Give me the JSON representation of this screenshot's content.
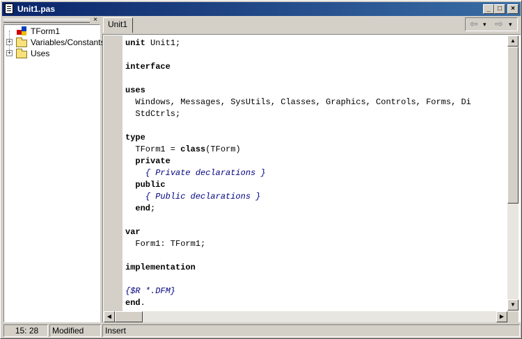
{
  "window": {
    "title": "Unit1.pas"
  },
  "title_buttons": {
    "minimize": "_",
    "maximize": "□",
    "close": "×"
  },
  "tree": {
    "items": [
      {
        "label": "TForm1",
        "icon": "class-icon"
      },
      {
        "label": "Variables/Constants",
        "icon": "folder-icon",
        "expander": "+"
      },
      {
        "label": "Uses",
        "icon": "folder-icon",
        "expander": "+"
      }
    ],
    "close_glyph": "×"
  },
  "tabs": [
    {
      "label": "Unit1"
    }
  ],
  "nav": {
    "back_glyph": "⇦",
    "forward_glyph": "⇨",
    "drop_glyph": "▾"
  },
  "code_lines": [
    [
      {
        "t": "unit",
        "k": "kw"
      },
      {
        "t": " Unit1;"
      }
    ],
    [],
    [
      {
        "t": "interface",
        "k": "kw"
      }
    ],
    [],
    [
      {
        "t": "uses",
        "k": "kw"
      }
    ],
    [
      {
        "t": "  Windows, Messages, SysUtils, Classes, Graphics, Controls, Forms, Di"
      }
    ],
    [
      {
        "t": "  StdCtrls;"
      }
    ],
    [],
    [
      {
        "t": "type",
        "k": "kw"
      }
    ],
    [
      {
        "t": "  TForm1 = "
      },
      {
        "t": "class",
        "k": "kw"
      },
      {
        "t": "(TForm)"
      }
    ],
    [
      {
        "t": "  "
      },
      {
        "t": "private",
        "k": "kw"
      }
    ],
    [
      {
        "t": "    "
      },
      {
        "t": "{ Private declarations }",
        "k": "cm"
      }
    ],
    [
      {
        "t": "  "
      },
      {
        "t": "public",
        "k": "kw"
      }
    ],
    [
      {
        "t": "    "
      },
      {
        "t": "{ Public declarations }",
        "k": "cm"
      }
    ],
    [
      {
        "t": "  "
      },
      {
        "t": "end",
        "k": "kw"
      },
      {
        "t": ";"
      }
    ],
    [],
    [
      {
        "t": "var",
        "k": "kw"
      }
    ],
    [
      {
        "t": "  Form1: TForm1;"
      }
    ],
    [],
    [
      {
        "t": "implementation",
        "k": "kw"
      }
    ],
    [],
    [
      {
        "t": "{$R *.DFM}",
        "k": "cm"
      }
    ],
    [
      {
        "t": "end",
        "k": "kw"
      },
      {
        "t": "."
      }
    ]
  ],
  "status": {
    "position": "15:  28",
    "modified": "Modified",
    "mode": "Insert"
  },
  "colors": {
    "title_gradient_start": "#0a246a",
    "title_gradient_end": "#3a6ea5",
    "comment": "#000080",
    "chrome": "#d4d0c8"
  }
}
